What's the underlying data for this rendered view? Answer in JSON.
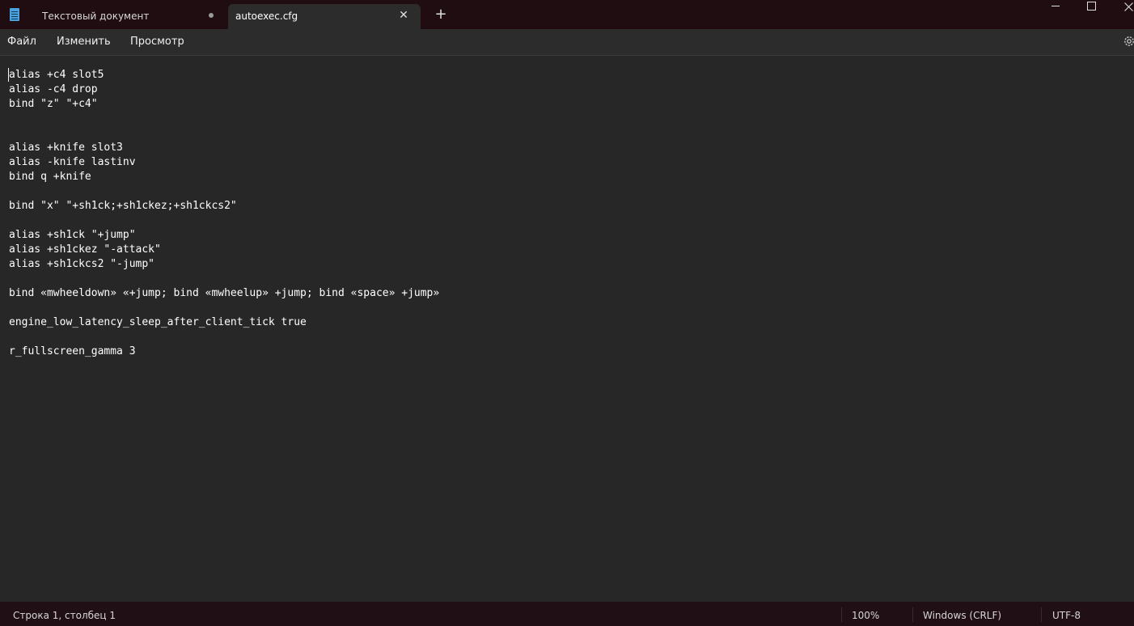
{
  "titlebar": {
    "tabs": [
      {
        "label": "Текстовый документ",
        "unsaved": true,
        "active": false
      },
      {
        "label": "autoexec.cfg",
        "unsaved": false,
        "active": true
      }
    ],
    "new_tab_glyph": "+",
    "close_glyph": "✕",
    "window_controls": [
      "minimize-icon",
      "maximize-icon",
      "close-icon"
    ]
  },
  "menu": {
    "file": "Файл",
    "edit": "Изменить",
    "view": "Просмотр",
    "settings_icon": "gear-icon"
  },
  "editor": {
    "content": "alias +c4 slot5\nalias -c4 drop\nbind \"z\" \"+c4\"\n\n\nalias +knife slot3\nalias -knife lastinv\nbind q +knife\n\nbind \"x\" \"+sh1ck;+sh1ckez;+sh1ckcs2\"\n\nalias +sh1ck \"+jump\"\nalias +sh1ckez \"-attack\"\nalias +sh1ckcs2 \"-jump\"\n\nbind «mwheeldown» «+jump; bind «mwheelup» +jump; bind «space» +jump»\n\nengine_low_latency_sleep_after_client_tick true\n\nr_fullscreen_gamma 3"
  },
  "status": {
    "position": "Строка 1, столбец 1",
    "zoom": "100%",
    "line_endings": "Windows (CRLF)",
    "encoding": "UTF-8"
  },
  "colors": {
    "titlebar_bg": "#1f0d12",
    "editor_bg": "#272727",
    "status_bg": "#200f14",
    "app_icon": "#4aa3df"
  }
}
